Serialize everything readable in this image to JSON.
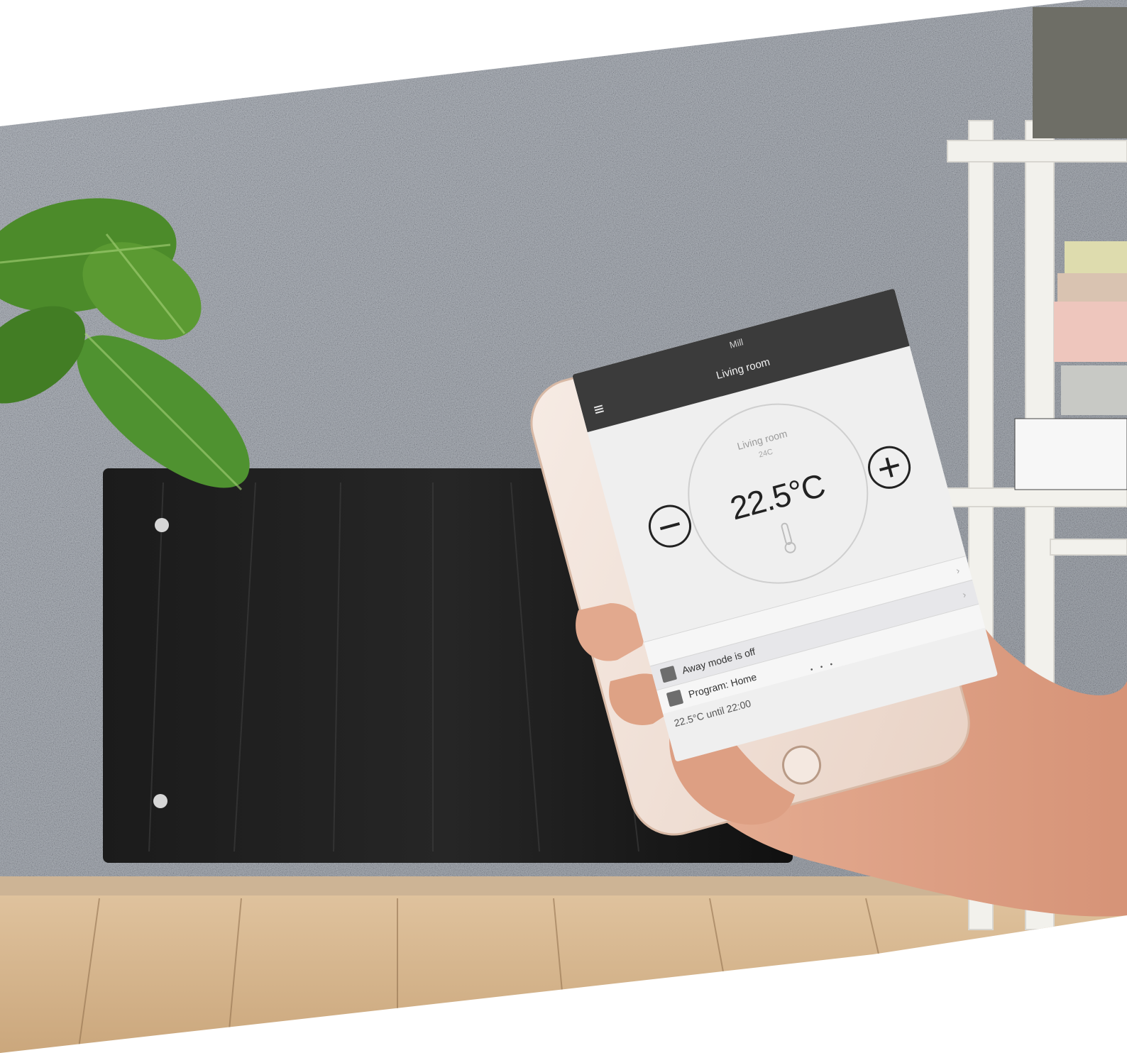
{
  "scene": {
    "colors": {
      "wall": "#a8adb2",
      "floor": "#d6b48c",
      "heater_panel": "#161616",
      "shelf": "#eeeeea",
      "phone_body": "#f2e3da",
      "skin": "#e2a98e"
    }
  },
  "phone_app": {
    "header": {
      "status": "Mill",
      "title": "Living room",
      "menu_icon": "menu-icon"
    },
    "thermostat": {
      "room": "Living room",
      "sub": "24C",
      "temperature": "22.5°C",
      "minus_icon": "minus-icon",
      "plus_icon": "plus-icon",
      "sensor_icon": "thermometer-icon"
    },
    "status_rows": [
      {
        "label": "",
        "icon": ""
      },
      {
        "label": "Away mode is off",
        "icon": "away-icon"
      },
      {
        "label": "Program: Home",
        "icon": "program-icon"
      }
    ],
    "footer_note": "22.5°C until 22:00"
  }
}
